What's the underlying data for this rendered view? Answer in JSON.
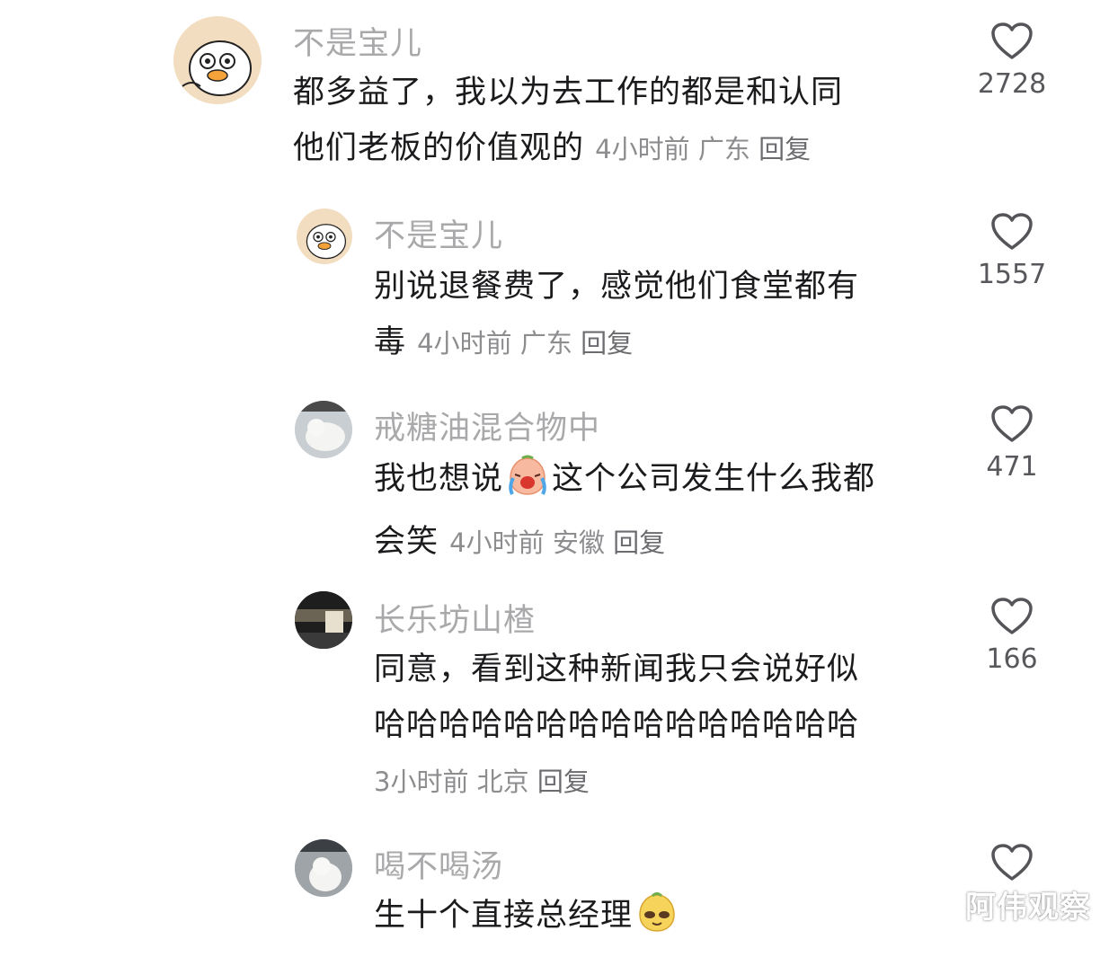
{
  "comments": [
    {
      "username": "不是宝儿",
      "line1": "都多益了，我以为去工作的都是和认同",
      "line2": "他们老板的价值观的",
      "time": "4小时前",
      "location": "广东",
      "reply": "回复",
      "likes": "2728"
    },
    {
      "username": "不是宝儿",
      "line1": "别说退餐费了，感觉他们食堂都有",
      "line2": "毒",
      "time": "4小时前",
      "location": "广东",
      "reply": "回复",
      "likes": "1557"
    },
    {
      "username": "戒糖油混合物中",
      "line1a": "我也想说",
      "line1b": "这个公司发生什么我都",
      "line2": "会笑",
      "time": "4小时前",
      "location": "安徽",
      "reply": "回复",
      "likes": "471"
    },
    {
      "username": "长乐坊山楂",
      "line1": "同意，看到这种新闻我只会说好似",
      "line2": "哈哈哈哈哈哈哈哈哈哈哈哈哈哈哈",
      "time": "3小时前",
      "location": "北京",
      "reply": "回复",
      "likes": "166"
    },
    {
      "username": "喝不喝汤",
      "line1": "生十个直接总经理"
    }
  ],
  "watermark": "阿伟观察",
  "colors": {
    "username": "#a9a9ab",
    "text": "#1b1b1d",
    "meta": "#8d8d90",
    "heart": "#555559"
  },
  "icons": [
    "heart-outline-icon",
    "crying-emoji-icon",
    "smug-emoji-icon"
  ]
}
